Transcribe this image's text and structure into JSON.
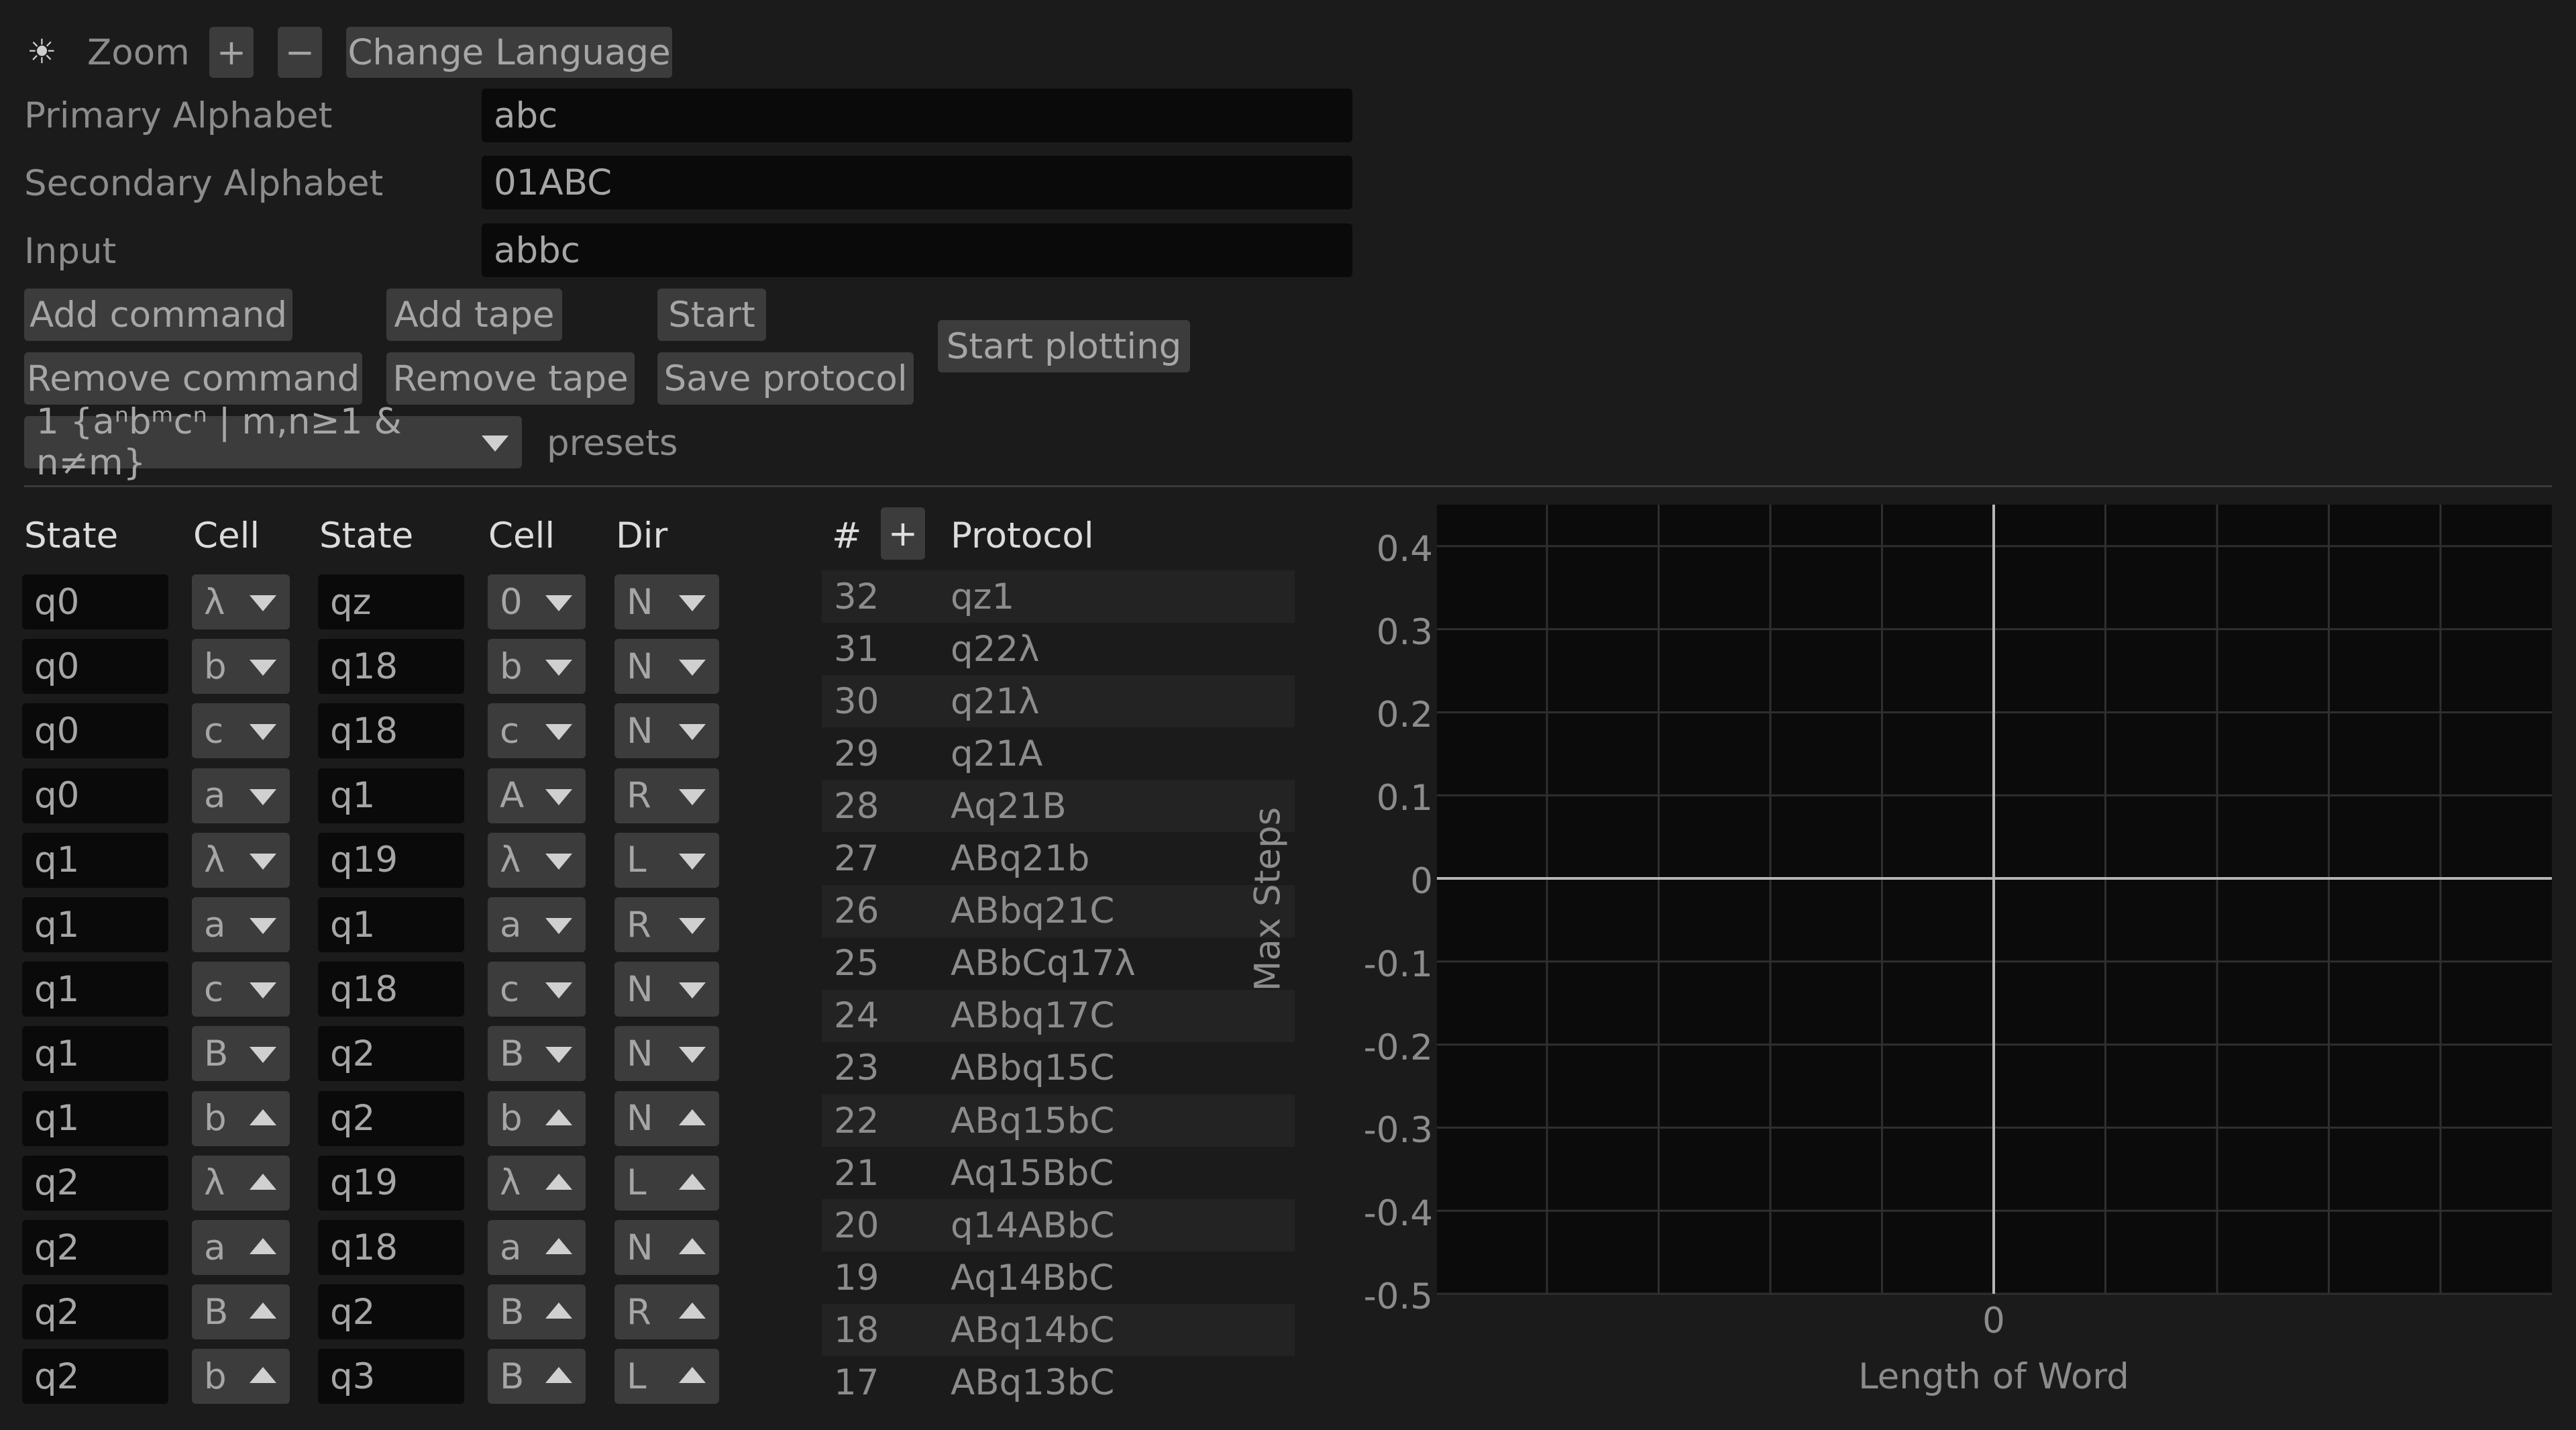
{
  "toolbar": {
    "theme_icon": "sun-icon",
    "zoom_label": "Zoom",
    "zoom_in": "+",
    "zoom_out": "−",
    "change_language": "Change Language"
  },
  "fields": {
    "primary_label": "Primary Alphabet",
    "primary_value": "abc",
    "secondary_label": "Secondary Alphabet",
    "secondary_value": "01ABC",
    "input_label": "Input",
    "input_value": "abbc"
  },
  "buttons": {
    "add_command": "Add command",
    "remove_command": "Remove command",
    "add_tape": "Add tape",
    "remove_tape": "Remove tape",
    "start": "Start",
    "save_protocol": "Save protocol",
    "start_plotting": "Start plotting"
  },
  "preset": {
    "selected": "1 {aⁿbᵐcⁿ | m,n≥1 & n≠m}",
    "label": "presets"
  },
  "commands": {
    "headers": [
      "State",
      "Cell",
      "State",
      "Cell",
      "Dir"
    ],
    "rows": [
      {
        "s1": "q0",
        "c1": "λ",
        "s2": "qz",
        "c2": "0",
        "d": "N",
        "open": "down"
      },
      {
        "s1": "q0",
        "c1": "b",
        "s2": "q18",
        "c2": "b",
        "d": "N",
        "open": "down"
      },
      {
        "s1": "q0",
        "c1": "c",
        "s2": "q18",
        "c2": "c",
        "d": "N",
        "open": "down"
      },
      {
        "s1": "q0",
        "c1": "a",
        "s2": "q1",
        "c2": "A",
        "d": "R",
        "open": "down"
      },
      {
        "s1": "q1",
        "c1": "λ",
        "s2": "q19",
        "c2": "λ",
        "d": "L",
        "open": "down"
      },
      {
        "s1": "q1",
        "c1": "a",
        "s2": "q1",
        "c2": "a",
        "d": "R",
        "open": "down"
      },
      {
        "s1": "q1",
        "c1": "c",
        "s2": "q18",
        "c2": "c",
        "d": "N",
        "open": "down"
      },
      {
        "s1": "q1",
        "c1": "B",
        "s2": "q2",
        "c2": "B",
        "d": "N",
        "open": "down"
      },
      {
        "s1": "q1",
        "c1": "b",
        "s2": "q2",
        "c2": "b",
        "d": "N",
        "open": "up"
      },
      {
        "s1": "q2",
        "c1": "λ",
        "s2": "q19",
        "c2": "λ",
        "d": "L",
        "open": "up"
      },
      {
        "s1": "q2",
        "c1": "a",
        "s2": "q18",
        "c2": "a",
        "d": "N",
        "open": "up"
      },
      {
        "s1": "q2",
        "c1": "B",
        "s2": "q2",
        "c2": "B",
        "d": "R",
        "open": "up"
      },
      {
        "s1": "q2",
        "c1": "b",
        "s2": "q3",
        "c2": "B",
        "d": "L",
        "open": "up"
      }
    ]
  },
  "protocol": {
    "hash_header": "#",
    "add_button": "+",
    "header": "Protocol",
    "rows": [
      {
        "n": "32",
        "v": "qz1"
      },
      {
        "n": "31",
        "v": "q22λ"
      },
      {
        "n": "30",
        "v": "q21λ"
      },
      {
        "n": "29",
        "v": "q21A"
      },
      {
        "n": "28",
        "v": "Aq21B"
      },
      {
        "n": "27",
        "v": "ABq21b"
      },
      {
        "n": "26",
        "v": "ABbq21C"
      },
      {
        "n": "25",
        "v": "ABbCq17λ"
      },
      {
        "n": "24",
        "v": "ABbq17C"
      },
      {
        "n": "23",
        "v": "ABbq15C"
      },
      {
        "n": "22",
        "v": "ABq15bC"
      },
      {
        "n": "21",
        "v": "Aq15BbC"
      },
      {
        "n": "20",
        "v": "q14ABbC"
      },
      {
        "n": "19",
        "v": "Aq14BbC"
      },
      {
        "n": "18",
        "v": "ABq14bC"
      },
      {
        "n": "17",
        "v": "ABq13bC"
      }
    ]
  },
  "chart_data": {
    "type": "line",
    "xlabel": "Length of Word",
    "ylabel": "Max Steps",
    "x_ticks": [
      "0"
    ],
    "y_ticks": [
      "0.4",
      "0.3",
      "0.2",
      "0.1",
      "0",
      "-0.1",
      "-0.2",
      "-0.3",
      "-0.4",
      "-0.5"
    ],
    "ylim": [
      -0.5,
      0.45
    ],
    "grid": true,
    "series": []
  }
}
